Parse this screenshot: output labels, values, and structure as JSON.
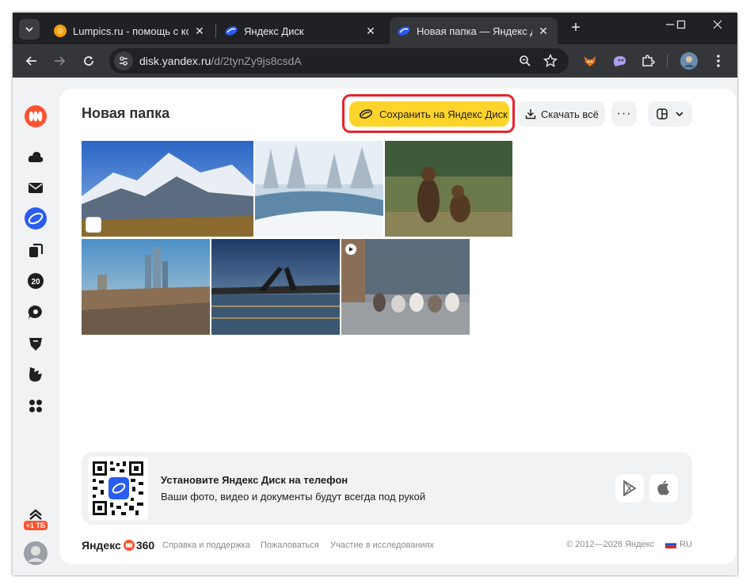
{
  "browser": {
    "tabs": [
      {
        "title": "Lumpics.ru - помощь с компьютером",
        "icon": "orange-circle-favicon"
      },
      {
        "title": "Яндекс Диск",
        "icon": "yandex-disk-favicon"
      },
      {
        "title": "Новая папка — Яндекс Диск",
        "icon": "yandex-disk-favicon",
        "active": true
      }
    ],
    "url_host": "disk.yandex.ru",
    "url_path": "/d/2tynZy9js8csdA"
  },
  "folder": {
    "title": "Новая папка",
    "save_label": "Сохранить на Яндекс Диск",
    "download_label": "Скачать всё",
    "more_label": "···"
  },
  "photos": [
    {
      "subject": "mountain"
    },
    {
      "subject": "winter-river"
    },
    {
      "subject": "bears"
    },
    {
      "subject": "moscow-city"
    },
    {
      "subject": "drawbridge"
    },
    {
      "subject": "ducks-video"
    }
  ],
  "promo": {
    "title": "Установите Яндекс Диск на телефон",
    "subtitle": "Ваши фото, видео и документы будут всегда под рукой"
  },
  "sidebar": {
    "badge_20": "20",
    "promo_label": "+1 ТБ"
  },
  "footer": {
    "brand": "Яндекс",
    "brand_suffix": "360",
    "links": [
      "Справка и поддержка",
      "Пожаловаться",
      "Участие в исследованиях"
    ],
    "copyright": "© 2012—2026 Яндекс",
    "lang": "RU"
  },
  "colors": {
    "accent_yellow": "#fed42b",
    "highlight_red": "#e8232a",
    "yandex_orange": "#fc5230",
    "disk_blue": "#2a5cf0"
  }
}
